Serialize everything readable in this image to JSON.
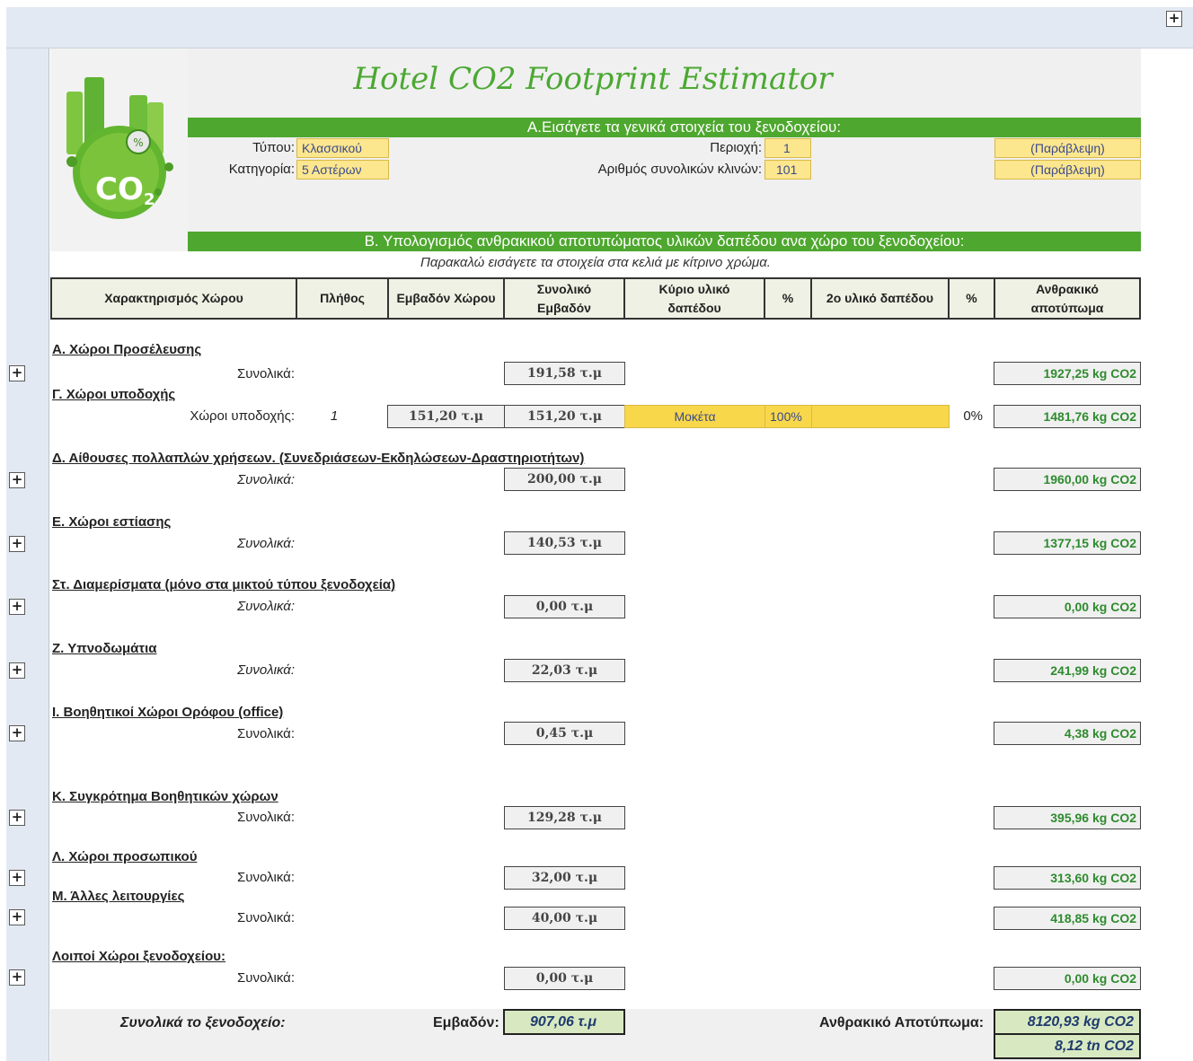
{
  "app": {
    "title": "Hotel CO2 Footprint Estimator"
  },
  "section_a": {
    "header": "Α.Εισάγετε τα γενικά στοιχεία του ξενοδοχείου:",
    "type_label": "Τύπου:",
    "type_value": "Κλασσικού",
    "category_label": "Κατηγορία:",
    "category_value": "5 Αστέρων",
    "region_label": "Περιοχή:",
    "region_value": "1",
    "beds_label": "Αριθμός συνολικών κλινών:",
    "beds_value": "101",
    "ignore1": "(Παράβλεψη)",
    "ignore2": "(Παράβλεψη)"
  },
  "section_b": {
    "header": "Β. Υπολογισμός ανθρακικού αποτυπώματος υλικών δαπέδου ανα χώρο του ξενοδοχείου:",
    "note": "Παρακαλώ εισάγετε τα στοιχεία στα κελιά με κίτρινο χρώμα."
  },
  "columns": {
    "space": "Χαρακτηρισμός Χώρου",
    "count": "Πλήθος",
    "area": "Εμβαδόν Χώρου",
    "total_area_1": "Συνολικό",
    "total_area_2": "Εμβαδόν",
    "main_material_1": "Κύριο υλικό",
    "main_material_2": "δαπέδου",
    "pct1": "%",
    "second_material": "2ο υλικό δαπέδου",
    "pct2": "%",
    "footprint_1": "Ανθρακικό",
    "footprint_2": "αποτύπωμα"
  },
  "sections": [
    {
      "title": "Α. Χώροι Προσέλευσης",
      "label": "Συνολικά:",
      "area": "191,58 τ.μ",
      "co2": "1927,25 kg CO2"
    },
    {
      "title": "Γ. Χώροι υποδοχής"
    },
    {
      "title": "Δ. Αίθουσες πολλαπλών χρήσεων. (Συνεδριάσεων-Εκδηλώσεων-Δραστηριοτήτων)",
      "label": "Συνολικά:",
      "area": "200,00 τ.μ",
      "co2": "1960,00 kg CO2"
    },
    {
      "title": "Ε. Χώροι εστίασης",
      "label": "Συνολικά:",
      "area": "140,53 τ.μ",
      "co2": "1377,15 kg CO2"
    },
    {
      "title": "Στ. Διαμερίσματα (μόνο στα μικτού τύπου ξενοδοχεία)",
      "label": "Συνολικά:",
      "area": "0,00 τ.μ",
      "co2": "0,00 kg CO2"
    },
    {
      "title": "Ζ. Υπνοδωμάτια",
      "label": "Συνολικά:",
      "area": "22,03 τ.μ",
      "co2": "241,99 kg CO2"
    },
    {
      "title": "Ι. Βοηθητικοί Χώροι Ορόφου (office)",
      "label": "Συνολικά:",
      "area": "0,45 τ.μ",
      "co2": "4,38 kg CO2"
    },
    {
      "title": "Κ. Συγκρότημα Βοηθητικών χώρων",
      "label": "Συνολικά:",
      "area": "129,28 τ.μ",
      "co2": "395,96 kg CO2"
    },
    {
      "title": "Λ. Χώροι προσωπικού",
      "label": "Συνολικά:",
      "area": "32,00 τ.μ",
      "co2": "313,60 kg CO2"
    },
    {
      "title": "Μ. Άλλες λειτουργίες",
      "label": "Συνολικά:",
      "area": "40,00 τ.μ",
      "co2": "418,85 kg CO2"
    },
    {
      "title": "Λοιποί Χώροι ξενοδοχείου:",
      "label": "Συνολικά:",
      "area": "0,00 τ.μ",
      "co2": "0,00 kg CO2"
    }
  ],
  "reception_row": {
    "label": "Χώροι υποδοχής:",
    "count": "1",
    "area": "151,20 τ.μ",
    "total_area": "151,20 τ.μ",
    "main_material": "Μοκέτα",
    "pct1": "100%",
    "second_material": "",
    "pct2": "0%",
    "co2": "1481,76 kg CO2"
  },
  "totals": {
    "label": "Συνολικά το ξενοδοχείο:",
    "area_label": "Εμβαδόν:",
    "area": "907,06 τ.μ",
    "co2_label": "Ανθρακικό Αποτύπωμα:",
    "co2_kg": "8120,93 kg CO2",
    "co2_tn": "8,12 tn CO2"
  },
  "group_buttons": {
    "symbol": "+"
  },
  "colors": {
    "accent_green": "#4ea72e",
    "title_green": "#4ba832",
    "input_yellow": "#fce68e",
    "value_green": "#2e8b2e",
    "total_bg": "#d8e9c2"
  }
}
